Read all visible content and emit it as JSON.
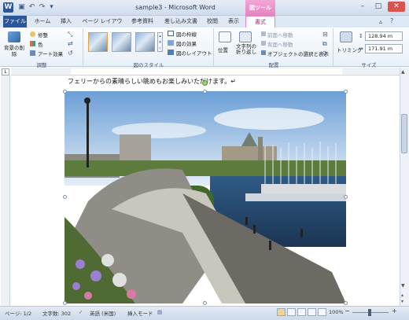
{
  "titlebar": {
    "title": "sample3 - Microsoft Word",
    "context_group": "図ツール",
    "minimize": "–",
    "maximize": "□",
    "close": "✕"
  },
  "tabs": [
    "ファイル",
    "ホーム",
    "挿入",
    "ページ レイアウト",
    "参考資料",
    "差し込み文書",
    "校閲",
    "表示",
    "書式"
  ],
  "ribbon": {
    "adjust": {
      "remove_bg": "背景の削除",
      "corrections": "修整",
      "color": "色",
      "art_effects": "アート効果",
      "label": "調整"
    },
    "styles": {
      "border": "図の枠線",
      "effects": "図の効果",
      "layout": "図のレイアウト",
      "label": "図のスタイル"
    },
    "arrange": {
      "position": "位置",
      "wrap": "文字列の折り返し",
      "bring_forward": "前面へ移動",
      "send_backward": "背面へ移動",
      "selection_pane": "オブジェクトの選択と表示",
      "label": "配置"
    },
    "size": {
      "crop": "トリミング",
      "height": "128.94 m",
      "width": "171.91 m",
      "label": "サイズ"
    }
  },
  "document": {
    "text": "フェリーからの素晴らしい眺めもお楽しみいただけます。↵"
  },
  "statusbar": {
    "page": "ページ: 1/2",
    "words": "文字数: 302",
    "language": "英語 (米国)",
    "mode": "挿入モード",
    "zoom": "100%",
    "minus": "−",
    "plus": "+"
  },
  "icons": {
    "word": "word-logo-icon",
    "save": "save-icon",
    "undo": "undo-icon",
    "redo": "redo-icon"
  }
}
